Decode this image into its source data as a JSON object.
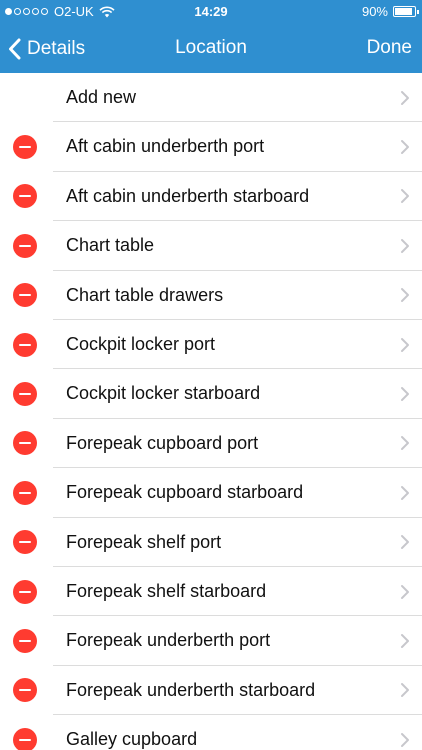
{
  "status_bar": {
    "carrier": "O2-UK",
    "time": "14:29",
    "battery": "90%"
  },
  "nav": {
    "back_label": "Details",
    "title": "Location",
    "done_label": "Done"
  },
  "add_row": {
    "label": "Add new"
  },
  "locations": [
    {
      "label": "Aft cabin underberth port"
    },
    {
      "label": "Aft cabin underberth starboard"
    },
    {
      "label": "Chart table"
    },
    {
      "label": "Chart table drawers"
    },
    {
      "label": "Cockpit locker port"
    },
    {
      "label": "Cockpit locker starboard"
    },
    {
      "label": "Forepeak cupboard port"
    },
    {
      "label": "Forepeak cupboard starboard"
    },
    {
      "label": "Forepeak shelf port"
    },
    {
      "label": "Forepeak shelf starboard"
    },
    {
      "label": "Forepeak underberth port"
    },
    {
      "label": "Forepeak underberth starboard"
    },
    {
      "label": "Galley cupboard"
    }
  ],
  "colors": {
    "nav_background": "#2f8fd0",
    "delete_red": "#ff3b30",
    "chevron": "#c7c7cc",
    "separator": "#dcdcdc"
  },
  "icons": {
    "delete": "delete-icon",
    "disclosure": "chevron-right-icon",
    "back": "chevron-left-icon",
    "wifi": "wifi-icon",
    "battery": "battery-icon",
    "signal": "signal-dots-icon"
  }
}
